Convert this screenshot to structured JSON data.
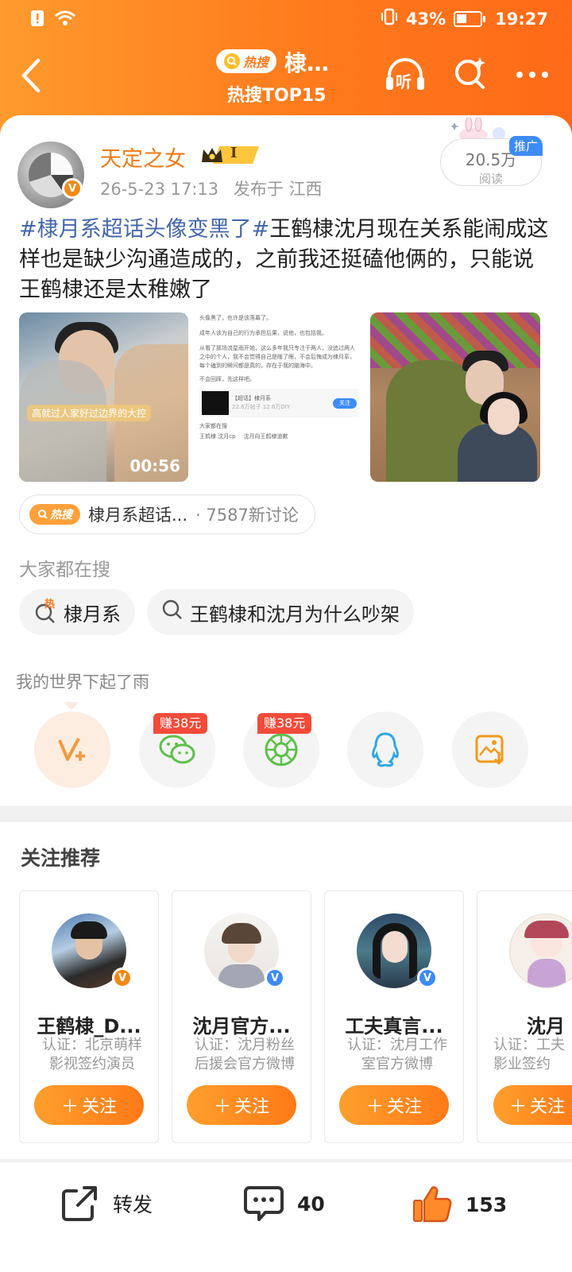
{
  "status_bar": {
    "battery_pct": "43%",
    "time": "19:27"
  },
  "nav": {
    "hot_label": "热搜",
    "title": "棣…",
    "subtitle": "热搜TOP15",
    "listen_label": "听"
  },
  "post": {
    "author": "天定之女",
    "level": "I",
    "verified_badge": "V",
    "date": "26-5-23 17:13",
    "location": "发布于 江西",
    "reads": "20.5万",
    "reads_label": "阅读",
    "promo": "推广",
    "hashtag": "#棣月系超话头像变黑了#",
    "text": "王鹤棣沈月现在关系能闹成这样也是缺少沟通造成的，之前我还挺磕他俩的，只能说王鹤棣还是太稚嫩了",
    "video": {
      "caption": "高就过人家好过边界的大控",
      "duration": "00:56"
    },
    "screenshot": {
      "line1": "头像黑了，也许是该落幕了。",
      "line2": "成年人该为自己的行为承担后果，说他，也包括我。",
      "line3": "从看了那场流星雨开始，这么多年我只专注于两人，没追过两人之中的个人，我不会觉得自己是瞎了眼，不会后悔成为棣月系，每个磕到的瞬间都是真的，存在于我的脑海中。",
      "line4": "不会回踩，先这样吧。",
      "super_name": "【超话】棣月系",
      "super_stats": "22.6万帖子 12.6万DIY",
      "follow_btn": "关注",
      "search_head": "大家都在搜",
      "search_a": "王鹤棣 沈月cp",
      "search_b": "沈月向王鹤棣道歉"
    }
  },
  "topic": {
    "badge": "热搜",
    "name": "棣月系超话...",
    "count": "· 7587新讨论"
  },
  "searching": {
    "title": "大家都在搜",
    "chips": [
      {
        "label": "棣月系",
        "badge": "热"
      },
      {
        "label": "王鹤棣和沈月为什么吵架"
      }
    ]
  },
  "music": "我的世界下起了雨",
  "share": {
    "earn_1": "赚38元",
    "earn_2": "赚38元"
  },
  "recommend": {
    "title": "关注推荐",
    "follow_label": "关注",
    "cards": [
      {
        "name": "王鹤棣_D...",
        "verify_1": "认证：北京萌样",
        "verify_2": "影视签约演员"
      },
      {
        "name": "沈月官方...",
        "verify_1": "认证：沈月粉丝",
        "verify_2": "后援会官方微博"
      },
      {
        "name": "工夫真言...",
        "verify_1": "认证：沈月工作",
        "verify_2": "室官方微博"
      },
      {
        "name": "沈月",
        "verify_1": "认证：工夫",
        "verify_2": "影业签约"
      }
    ]
  },
  "actions": {
    "repost": "转发",
    "comments": "40",
    "likes": "153"
  },
  "colors": {
    "brand_orange": "#ff7a1c",
    "hashtag_blue": "#4467a8",
    "author_orange": "#ee7a14"
  }
}
